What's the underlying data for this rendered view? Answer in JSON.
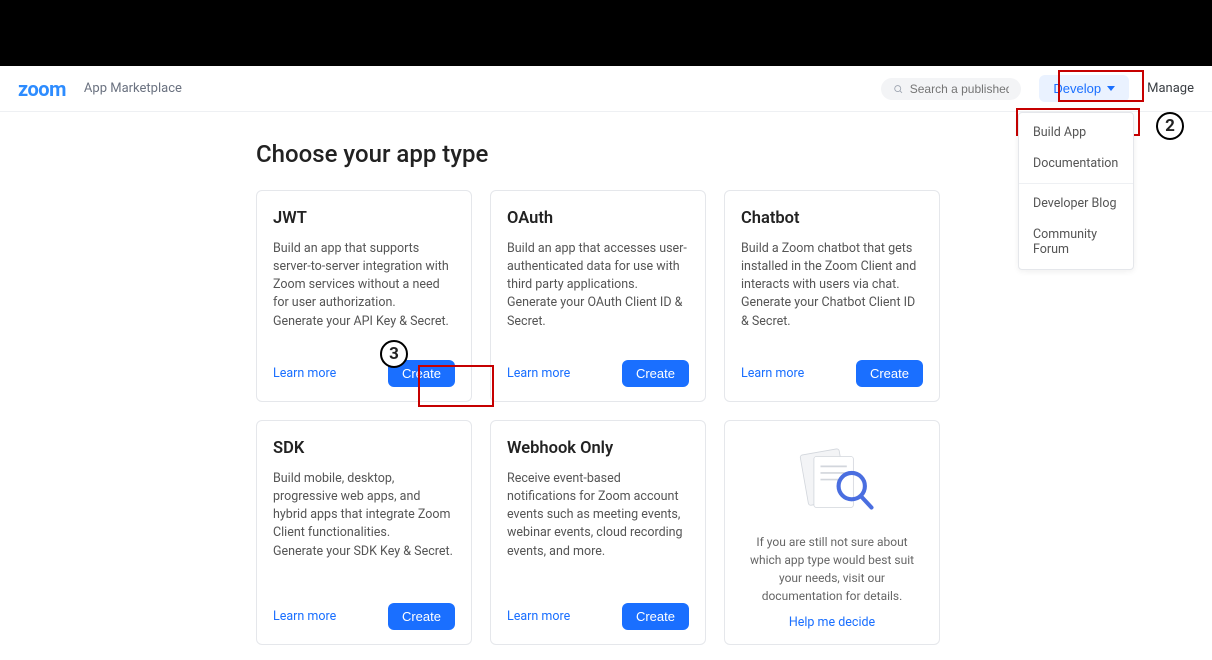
{
  "header": {
    "logo": "zoom",
    "sub": "App Marketplace",
    "search_placeholder": "Search a published app",
    "develop_label": "Develop",
    "manage_label": "Manage"
  },
  "dropdown": {
    "build_app": "Build App",
    "documentation": "Documentation",
    "developer_blog": "Developer Blog",
    "community_forum": "Community Forum"
  },
  "page_title": "Choose your app type",
  "cards": {
    "jwt": {
      "title": "JWT",
      "desc": "Build an app that supports server-to-server integration with Zoom services without a need for user authorization.\nGenerate your API Key & Secret.",
      "learn": "Learn more",
      "create": "Create"
    },
    "oauth": {
      "title": "OAuth",
      "desc": "Build an app that accesses user-authenticated data for use with third party applications.\nGenerate your OAuth Client ID & Secret.",
      "learn": "Learn more",
      "create": "Create"
    },
    "chatbot": {
      "title": "Chatbot",
      "desc": "Build a Zoom chatbot that gets installed in the Zoom Client and interacts with users via chat.\nGenerate your Chatbot Client ID & Secret.",
      "learn": "Learn more",
      "create": "Create"
    },
    "sdk": {
      "title": "SDK",
      "desc": "Build mobile, desktop, progressive web apps, and hybrid apps that integrate Zoom Client functionalities.\nGenerate your SDK Key & Secret.",
      "learn": "Learn more",
      "create": "Create"
    },
    "webhook": {
      "title": "Webhook Only",
      "desc": "Receive event-based notifications for Zoom account events such as meeting events, webinar events, cloud recording events, and more.",
      "learn": "Learn more",
      "create": "Create"
    },
    "help": {
      "text": "If you are still not sure about which app type would best suit your needs, visit our documentation for details.",
      "link": "Help me decide"
    }
  },
  "annotations": {
    "step2": "2",
    "step3": "3"
  }
}
